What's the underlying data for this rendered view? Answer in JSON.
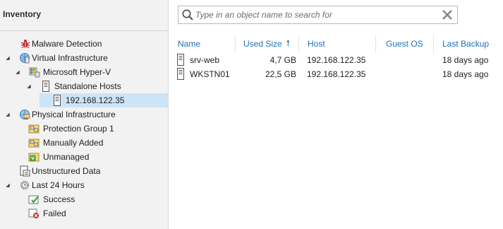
{
  "inventory": {
    "title": "Inventory",
    "tree": [
      {
        "label": "Malware Detection",
        "icon": "bug-icon"
      },
      {
        "label": "Virtual Infrastructure",
        "icon": "globe-servers-icon",
        "expanded": true
      },
      {
        "label": "Microsoft Hyper-V",
        "icon": "hyperv-icon",
        "expanded": true
      },
      {
        "label": "Standalone Hosts",
        "icon": "server-icon",
        "expanded": true
      },
      {
        "label": "192.168.122.35",
        "icon": "server-icon",
        "selected": true
      },
      {
        "label": "Physical Infrastructure",
        "icon": "globe-computers-icon",
        "expanded": true
      },
      {
        "label": "Protection Group 1",
        "icon": "protection-group-icon"
      },
      {
        "label": "Manually Added",
        "icon": "protection-group-icon"
      },
      {
        "label": "Unmanaged",
        "icon": "unmanaged-group-icon"
      },
      {
        "label": "Unstructured Data",
        "icon": "storage-icon"
      },
      {
        "label": "Last 24 Hours",
        "icon": "gear-clock-icon",
        "expanded": true
      },
      {
        "label": "Success",
        "icon": "success-check-icon"
      },
      {
        "label": "Failed",
        "icon": "failed-x-icon"
      }
    ]
  },
  "search": {
    "placeholder": "Type in an object name to search for",
    "value": ""
  },
  "table": {
    "columns": [
      "Name",
      "Used Size",
      "Host",
      "Guest OS",
      "Last Backup"
    ],
    "sorted_column": "Used Size",
    "sort_direction": "ascending",
    "rows": [
      {
        "name": "srv-web",
        "used_size": "4,7 GB",
        "host": "192.168.122.35",
        "guest_os": "",
        "last_backup": "18 days ago"
      },
      {
        "name": "WKSTN01",
        "used_size": "22,5 GB",
        "host": "192.168.122.35",
        "guest_os": "",
        "last_backup": "18 days ago"
      }
    ]
  },
  "colors": {
    "accent": "#1f6fb8",
    "selection": "#cce4f7",
    "pane_bg": "#f2f2f2"
  }
}
